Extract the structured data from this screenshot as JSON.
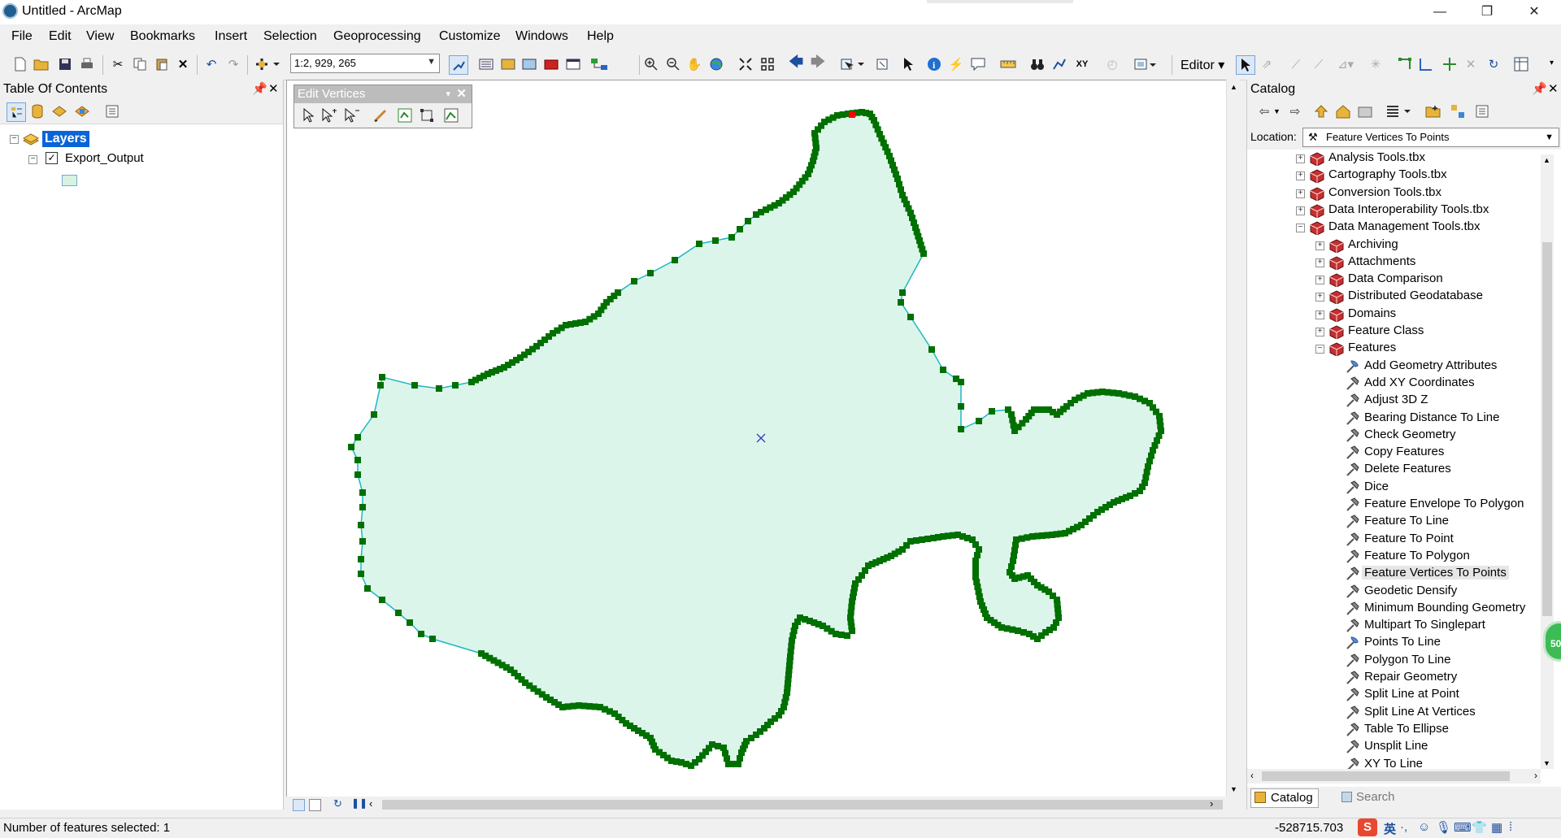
{
  "window": {
    "title": "Untitled - ArcMap",
    "minimize": "—",
    "restore": "❐",
    "close": "✕"
  },
  "menu": [
    "File",
    "Edit",
    "View",
    "Bookmarks",
    "Insert",
    "Selection",
    "Geoprocessing",
    "Customize",
    "Windows",
    "Help"
  ],
  "toolbar": {
    "scale": "1:2, 929, 265",
    "editor_label": "Editor"
  },
  "toc": {
    "title": "Table Of Contents",
    "root_label": "Layers",
    "layer_label": "Export_Output",
    "layer_checked": true
  },
  "edit_vertices": {
    "title": "Edit Vertices"
  },
  "catalog": {
    "title": "Catalog",
    "location_label": "Location:",
    "location_value": "Feature Vertices To Points",
    "toolboxes": [
      "Analysis Tools.tbx",
      "Cartography Tools.tbx",
      "Conversion Tools.tbx",
      "Data Interoperability Tools.tbx",
      "Data Management Tools.tbx"
    ],
    "toolsets": [
      "Archiving",
      "Attachments",
      "Data Comparison",
      "Distributed Geodatabase",
      "Domains",
      "Feature Class",
      "Features"
    ],
    "tools": [
      "Add Geometry Attributes",
      "Add XY Coordinates",
      "Adjust 3D Z",
      "Bearing Distance To Line",
      "Check Geometry",
      "Copy Features",
      "Delete Features",
      "Dice",
      "Feature Envelope To Polygon",
      "Feature To Line",
      "Feature To Point",
      "Feature To Polygon",
      "Feature Vertices To Points",
      "Geodetic Densify",
      "Minimum Bounding Geometry",
      "Multipart To Singlepart",
      "Points To Line",
      "Polygon To Line",
      "Repair Geometry",
      "Split Line at Point",
      "Split Line At Vertices",
      "Table To Ellipse",
      "Unsplit Line",
      "XY To Line"
    ],
    "selected_tool": "Feature Vertices To Points",
    "tab_catalog": "Catalog",
    "tab_search": "Search"
  },
  "status": {
    "selected_text": "Number of features selected: 1",
    "coordinate": "-528715.703",
    "ime_label": "英",
    "badge": "50"
  },
  "colors": {
    "polygon_fill": "#dcf5ea",
    "polygon_edge": "#1cb8c4",
    "vertex": "#007000",
    "selected_vertex": "#ff0000",
    "selection_blue": "#0a64d8"
  }
}
